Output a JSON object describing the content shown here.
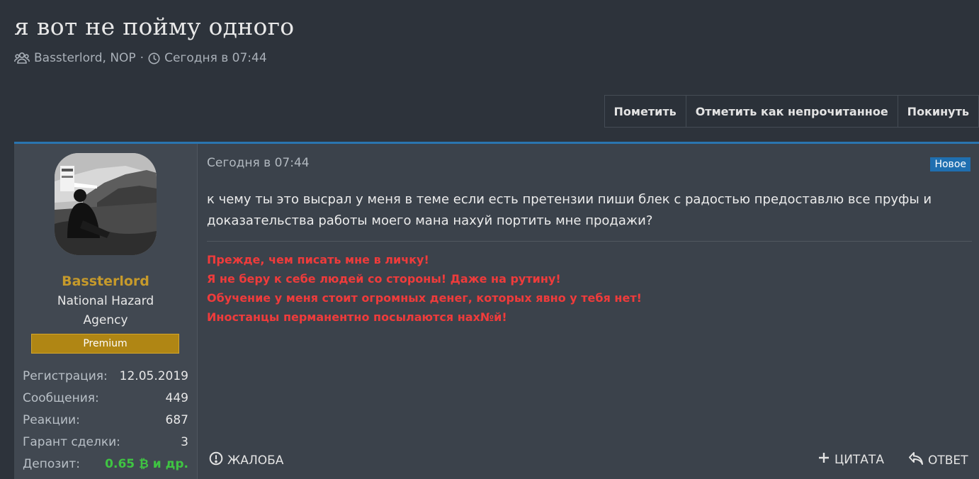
{
  "thread": {
    "title": "я вот не пойму одного",
    "participants": "Bassterlord, NOP",
    "separator": "·",
    "date": "Сегодня в 07:44"
  },
  "actions": {
    "mark": "Пометить",
    "mark_unread": "Отметить как непрочитанное",
    "leave": "Покинуть"
  },
  "user": {
    "name": "Bassterlord",
    "title": "National Hazard Agency",
    "banner": "Premium",
    "stats": [
      {
        "label": "Регистрация:",
        "value": "12.05.2019"
      },
      {
        "label": "Сообщения:",
        "value": "449"
      },
      {
        "label": "Реакции:",
        "value": "687"
      },
      {
        "label": "Гарант сделки:",
        "value": "3"
      }
    ],
    "deposit": {
      "label": "Депозит:",
      "value": "0.65 ₿ и др."
    }
  },
  "post": {
    "date": "Сегодня в 07:44",
    "badge": "Новое",
    "body": "к чему ты это высрал у меня в теме если есть претензии пиши блек с радостью предоставлю все пруфы и доказательства работы моего мана нахуй портить мне продажи?",
    "signature": [
      "Прежде, чем писать мне в личку!",
      "Я не беру к себе людей со стороны! Даже на рутину!",
      "Обучение у меня стоит огромных денег, которых явно у тебя нет!",
      "Иностанцы перманентно посылаются нах№й!"
    ]
  },
  "footer": {
    "report": "ЖАЛОБА",
    "quote": "ЦИТАТА",
    "reply": "ОТВЕТ"
  },
  "colors": {
    "background": "#2d333b",
    "accent": "#2a75b0",
    "username": "#c69a2b",
    "banner": "#b08614",
    "signature": "#ef3b3b",
    "deposit": "#3fc542"
  }
}
